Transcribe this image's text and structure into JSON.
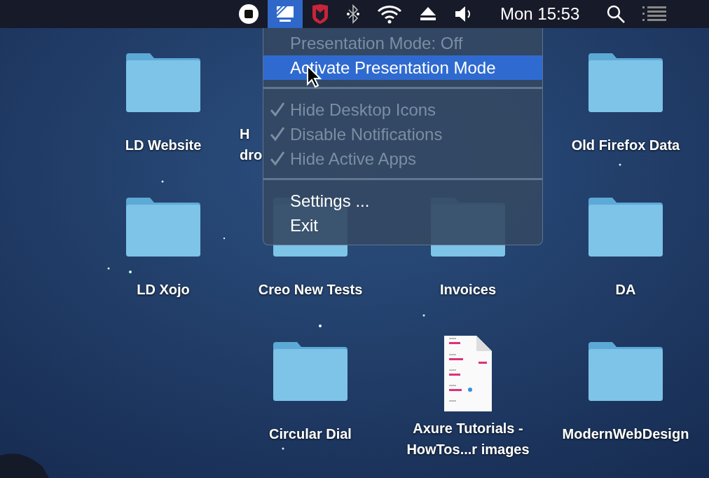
{
  "menu_bar": {
    "items": [
      {
        "kind": "stop",
        "selected": false
      },
      {
        "kind": "presentation",
        "selected": true
      },
      {
        "kind": "shield",
        "selected": false
      },
      {
        "kind": "bluetooth",
        "selected": false
      },
      {
        "kind": "wifi",
        "selected": false
      },
      {
        "kind": "eject",
        "selected": false
      },
      {
        "kind": "volume",
        "selected": false
      },
      {
        "kind": "clock",
        "label": "Mon 15:53",
        "selected": false
      },
      {
        "kind": "search",
        "selected": false
      },
      {
        "kind": "list",
        "selected": false
      }
    ]
  },
  "menu": {
    "items": [
      {
        "kind": "header",
        "label": "Presentation Mode: Off",
        "disabled": true,
        "selected": false
      },
      {
        "kind": "action",
        "label": "Activate Presentation Mode",
        "disabled": false,
        "selected": true
      },
      {
        "kind": "separator"
      },
      {
        "kind": "check",
        "label": "Hide Desktop Icons",
        "checked": true,
        "disabled": true,
        "selected": false
      },
      {
        "kind": "check",
        "label": "Disable Notifications",
        "checked": true,
        "disabled": true,
        "selected": false
      },
      {
        "kind": "check",
        "label": "Hide Active Apps",
        "checked": true,
        "disabled": true,
        "selected": false
      },
      {
        "kind": "separator"
      },
      {
        "kind": "action",
        "label": "Settings ...",
        "disabled": false,
        "selected": false
      },
      {
        "kind": "action",
        "label": "Exit",
        "disabled": false,
        "selected": false
      }
    ]
  },
  "desktop": {
    "rows": [
      [
        {
          "kind": "folder",
          "label": [
            "LD Website"
          ]
        },
        {
          "kind": "folder",
          "label": [
            "H",
            "dro"
          ],
          "partial": true
        },
        {
          "kind": "empty"
        },
        {
          "kind": "folder",
          "label": [
            "Old Firefox Data"
          ]
        }
      ],
      [
        {
          "kind": "folder",
          "label": [
            "LD Xojo"
          ]
        },
        {
          "kind": "folder",
          "label": [
            "Creo New Tests"
          ]
        },
        {
          "kind": "folder",
          "label": [
            "Invoices"
          ]
        },
        {
          "kind": "folder",
          "label": [
            "DA"
          ]
        }
      ],
      [
        {
          "kind": "empty"
        },
        {
          "kind": "folder",
          "label": [
            "Circular Dial"
          ]
        },
        {
          "kind": "document",
          "label": [
            "Axure Tutorials -",
            "HowTos...r images"
          ]
        },
        {
          "kind": "folder",
          "label": [
            "ModernWebDesign"
          ]
        }
      ]
    ]
  }
}
